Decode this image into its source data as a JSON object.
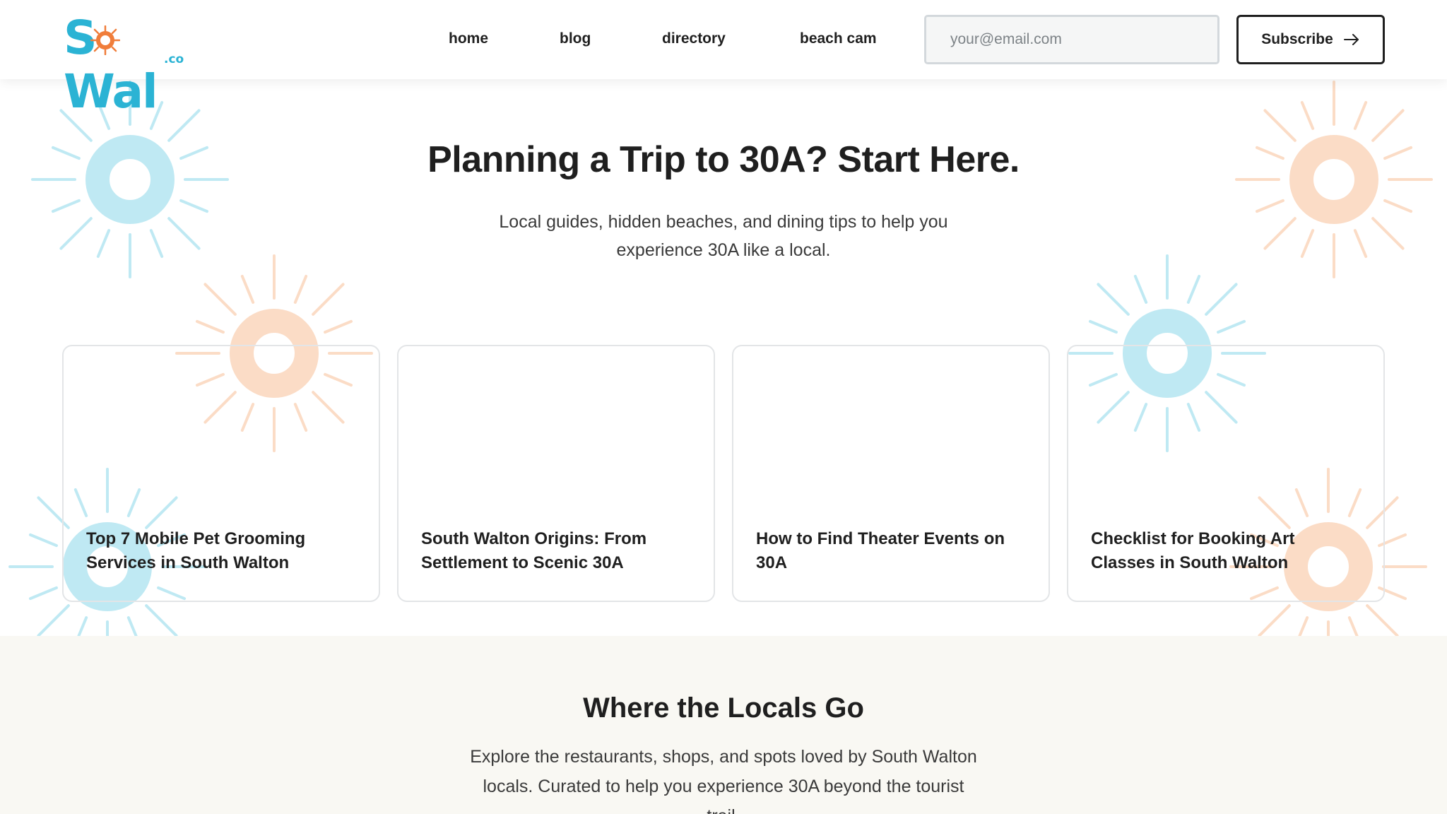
{
  "brand": {
    "logo_text": "SoWal",
    "logo_suffix": ".co",
    "colors": {
      "teal": "#2bb3d4",
      "orange": "#f07d3a",
      "cream": "#f9f8f3",
      "text": "#1f1f1f"
    }
  },
  "header": {
    "nav": [
      {
        "label": "home"
      },
      {
        "label": "blog"
      },
      {
        "label": "directory"
      },
      {
        "label": "beach cam"
      }
    ],
    "email_placeholder": "your@email.com",
    "subscribe_label": "Subscribe",
    "subscribe_icon": "arrow-right-icon"
  },
  "hero": {
    "title": "Planning a Trip to 30A? Start Here.",
    "subtitle": "Local guides, hidden beaches, and dining tips to help you experience 30A like a local.",
    "decoration_icon": "sunburst-icon"
  },
  "cards": [
    {
      "title": "Top 7 Mobile Pet Grooming Services in South Walton"
    },
    {
      "title": "South Walton Origins: From Settlement to Scenic 30A"
    },
    {
      "title": "How to Find Theater Events on 30A"
    },
    {
      "title": "Checklist for Booking Art Classes in South Walton"
    }
  ],
  "locals": {
    "title": "Where the Locals Go",
    "description": "Explore the restaurants, shops, and spots loved by South Walton locals. Curated to help you experience 30A beyond the tourist trail."
  }
}
